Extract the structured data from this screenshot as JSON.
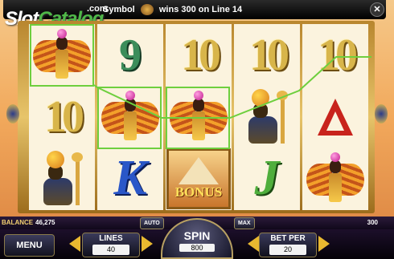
{
  "watermark": {
    "slot": "Slot",
    "catalog": "Catalog"
  },
  "topbar": {
    "partial_site": ".com",
    "message_symbol": "Symbol",
    "message_wins": "wins 300 on Line 14",
    "close_glyph": "✕"
  },
  "reels": [
    [
      "isis",
      "ten",
      "ra"
    ],
    [
      "nine",
      "isis",
      "K"
    ],
    [
      "ten",
      "isis",
      "BONUS"
    ],
    [
      "ten",
      "ra",
      "J"
    ],
    [
      "ten",
      "A",
      "isis"
    ]
  ],
  "symbols": {
    "ten": "10",
    "nine": "9",
    "K": "K",
    "J": "J",
    "bonus": "BONUS"
  },
  "winning_line": 14,
  "status": {
    "balance_label": "BALANCE",
    "balance": "46,275",
    "win": "300",
    "auto": "AUTO",
    "max": "MAX"
  },
  "controls": {
    "menu": "MENU",
    "lines_label": "LINES",
    "lines": "40",
    "spin_label": "SPIN",
    "total_bet": "800",
    "bet_label": "BET PER",
    "bet": "20"
  },
  "colors": {
    "win_line": "#6ecf3e",
    "accent_gold": "#e8b830"
  }
}
